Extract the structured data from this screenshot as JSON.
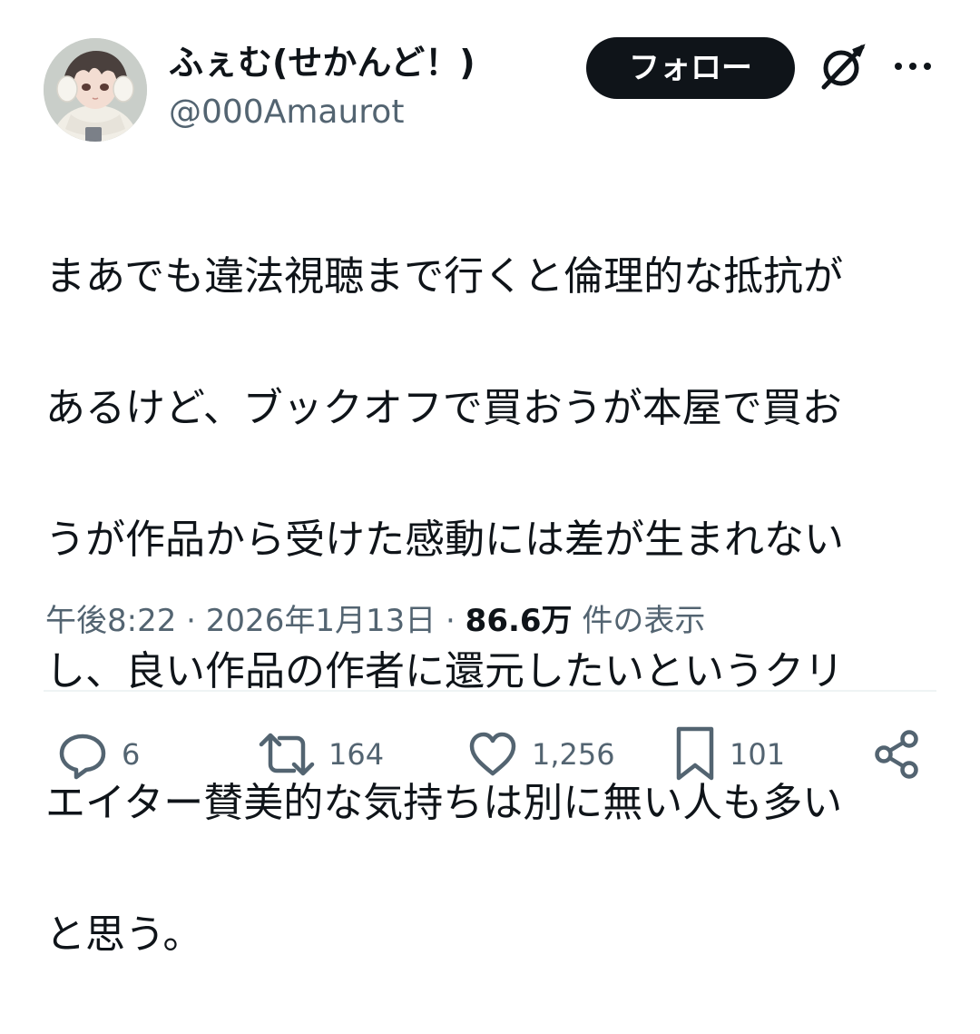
{
  "author": {
    "display_name": "ふぇむ(せかんど！)",
    "handle": "@000Amaurot"
  },
  "follow_label": "フォロー",
  "tweet_lines": [
    "まあでも違法視聴まで行くと倫理的な抵抗が",
    "あるけど、ブックオフで買おうが本屋で買お",
    "うが作品から受けた感動には差が生まれない",
    "し、良い作品の作者に還元したいというクリ",
    "エイター賛美的な気持ちは別に無い人も多い",
    "と思う。"
  ],
  "meta": {
    "time": "午後8:22",
    "separator": " · ",
    "date": "2026年1月13日",
    "views_count": "86.6万",
    "views_label": " 件の表示"
  },
  "actions": {
    "replies": "6",
    "reposts": "164",
    "likes": "1,256",
    "bookmarks": "101"
  },
  "icons": {
    "avatar": "avatar",
    "grok": "grok-icon",
    "more": "more-icon",
    "reply": "reply-icon",
    "repost": "repost-icon",
    "like": "heart-icon",
    "bookmark": "bookmark-icon",
    "share": "share-icon"
  },
  "colors": {
    "text_primary": "#0f1419",
    "text_secondary": "#536471",
    "follow_bg": "#0f1419",
    "follow_text": "#ffffff",
    "divider": "#eff3f4"
  }
}
